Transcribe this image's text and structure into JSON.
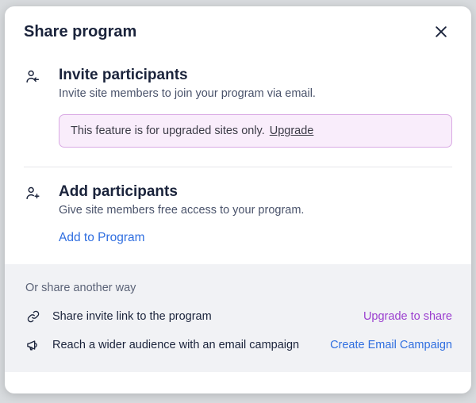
{
  "modal": {
    "title": "Share program"
  },
  "invite": {
    "title": "Invite participants",
    "desc": "Invite site members to join your program via email.",
    "banner_text": "This feature is for upgraded sites only.",
    "banner_link": "Upgrade"
  },
  "add": {
    "title": "Add participants",
    "desc": "Give site members free access to your program.",
    "action": "Add to Program"
  },
  "footer": {
    "heading": "Or share another way",
    "link_row": {
      "text": "Share invite link to the program",
      "action": "Upgrade to share"
    },
    "email_row": {
      "text": "Reach a wider audience with an email campaign",
      "action": "Create Email Campaign"
    }
  }
}
